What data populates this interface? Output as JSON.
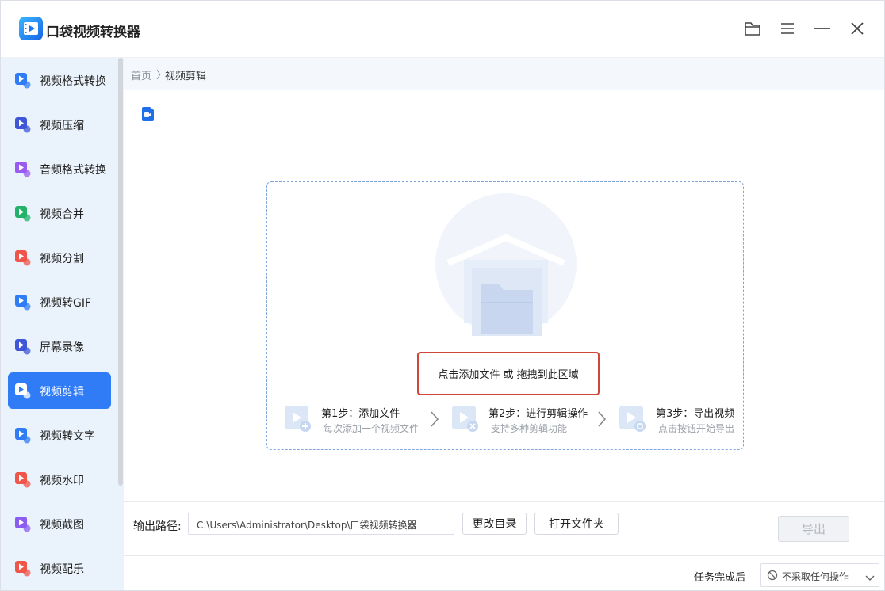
{
  "app": {
    "title": "口袋视频转换器"
  },
  "window_buttons": {
    "folder": "folder-icon",
    "menu": "menu-icon",
    "minimize": "minimize-icon",
    "close": "close-icon"
  },
  "sidebar": {
    "items": [
      {
        "label": "视频格式转换",
        "icon": "video-convert-icon",
        "color": "#2f7cf6",
        "active": false
      },
      {
        "label": "视频压缩",
        "icon": "video-compress-icon",
        "color": "#3f57d6",
        "active": false
      },
      {
        "label": "音频格式转换",
        "icon": "audio-convert-icon",
        "color": "#9a5cf0",
        "active": false
      },
      {
        "label": "视频合并",
        "icon": "video-merge-icon",
        "color": "#22b26a",
        "active": false
      },
      {
        "label": "视频分割",
        "icon": "video-split-icon",
        "color": "#f0554a",
        "active": false
      },
      {
        "label": "视频转GIF",
        "icon": "video-gif-icon",
        "color": "#2f7cf6",
        "active": false
      },
      {
        "label": "屏幕录像",
        "icon": "screen-record-icon",
        "color": "#3f57d6",
        "active": false
      },
      {
        "label": "视频剪辑",
        "icon": "video-edit-icon",
        "color": "#ffffff",
        "active": true
      },
      {
        "label": "视频转文字",
        "icon": "video-to-text-icon",
        "color": "#2f7cf6",
        "active": false
      },
      {
        "label": "视频水印",
        "icon": "video-watermark-icon",
        "color": "#f0554a",
        "active": false
      },
      {
        "label": "视频截图",
        "icon": "video-screenshot-icon",
        "color": "#8b5cf0",
        "active": false
      },
      {
        "label": "视频配乐",
        "icon": "video-music-icon",
        "color": "#f0554a",
        "active": false
      }
    ]
  },
  "breadcrumb": {
    "home": "首页",
    "separator": "〉",
    "current": "视频剪辑"
  },
  "dropzone": {
    "hint": "点击添加文件  或  拖拽到此区域",
    "steps": [
      {
        "title": "第1步：添加文件",
        "subtitle": "每次添加一个视频文件",
        "icon": "add-file-icon"
      },
      {
        "title": "第2步：进行剪辑操作",
        "subtitle": "支持多种剪辑功能",
        "icon": "scissors-icon"
      },
      {
        "title": "第3步：导出视频",
        "subtitle": "点击按钮开始导出",
        "icon": "export-icon"
      }
    ]
  },
  "output": {
    "label": "输出路径:",
    "path": "C:\\Users\\Administrator\\Desktop\\口袋视频转换器",
    "change_dir": "更改目录",
    "open_folder": "打开文件夹",
    "export": "导出"
  },
  "after_task": {
    "label": "任务完成后",
    "value": "不采取任何操作"
  },
  "colors": {
    "accent": "#2f7cf6",
    "hint_border": "#d0463a",
    "sidebar_bg": "#eaf3fb"
  }
}
